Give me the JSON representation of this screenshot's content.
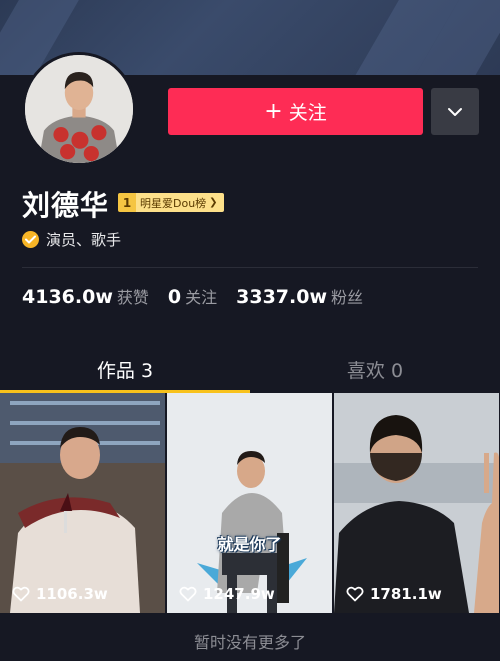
{
  "profile": {
    "name": "刘德华",
    "rank_number": "1",
    "rank_label": "明星爱Dou榜",
    "verified_label": "演员、歌手",
    "follow_label": "关注",
    "stats": [
      {
        "value": "4136.0w",
        "label": "获赞"
      },
      {
        "value": "0",
        "label": "关注"
      },
      {
        "value": "3337.0w",
        "label": "粉丝"
      }
    ]
  },
  "tabs": [
    {
      "label": "作品 3",
      "active": true
    },
    {
      "label": "喜欢 0",
      "active": false
    }
  ],
  "videos": [
    {
      "likes": "1106.3w"
    },
    {
      "likes": "1247.9w",
      "caption": "就是你了"
    },
    {
      "likes": "1781.1w"
    }
  ],
  "footer": "暂时没有更多了",
  "colors": {
    "background": "#161823",
    "follow_button": "#fe2c55",
    "tab_indicator": "#f8c21c",
    "verified_badge": "#f7b527"
  },
  "icons": {
    "follow": "plus-icon",
    "more": "chevron-down-icon",
    "verified": "check-badge-icon",
    "likes": "heart-outline-icon"
  }
}
